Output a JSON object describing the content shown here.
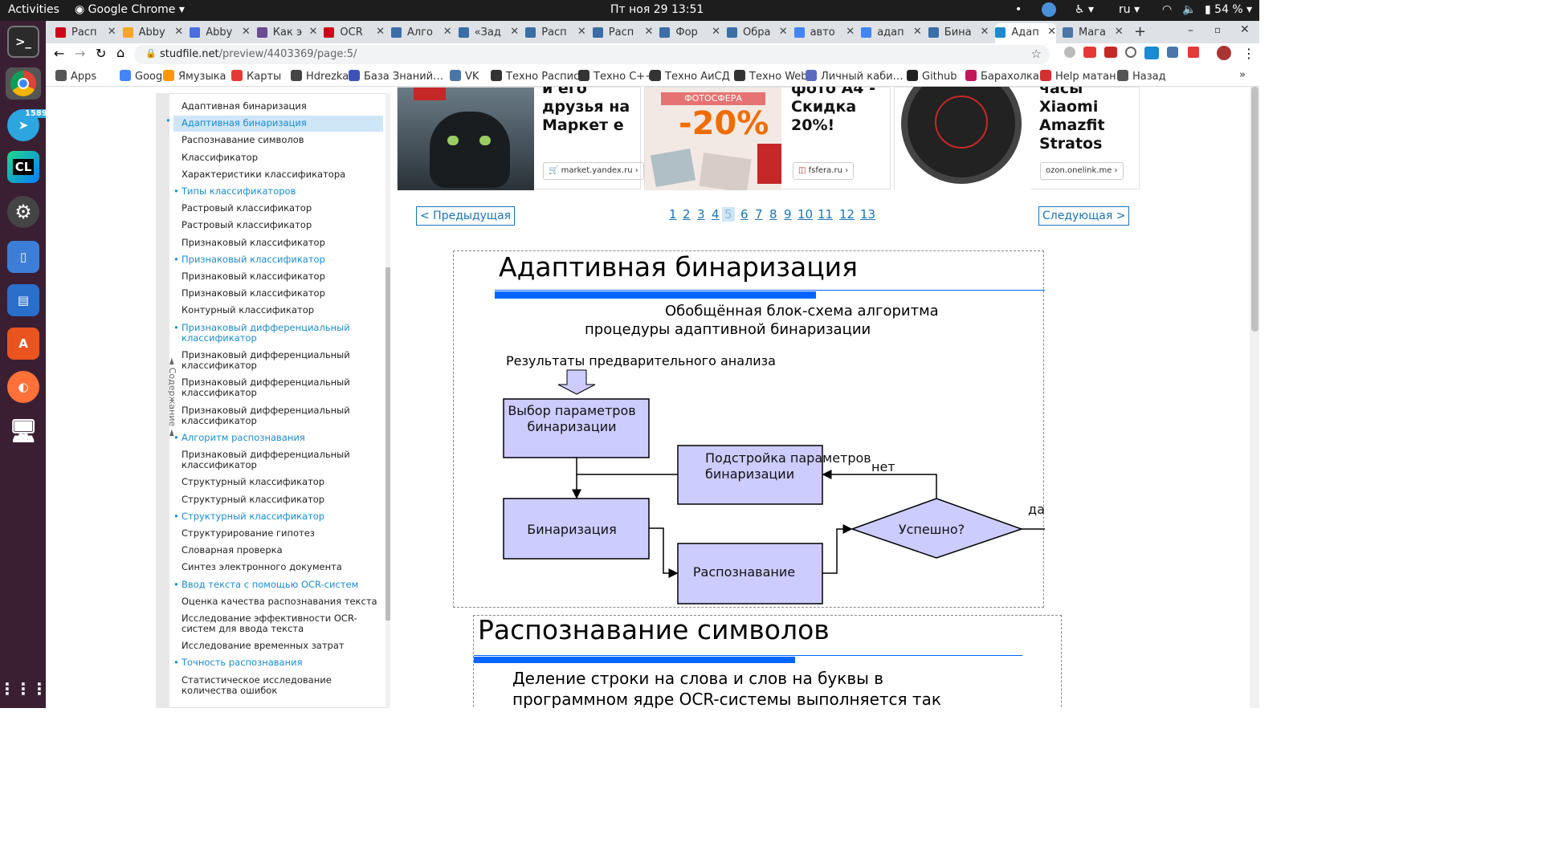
{
  "topbar": {
    "activities": "Activities",
    "app": "Google Chrome",
    "clock": "Пт ноя 29  13:51",
    "lang": "ru",
    "battery": "54 %"
  },
  "dock": {
    "telegram_badge": "1589",
    "clion": "CL"
  },
  "tabs": [
    {
      "label": "Расп",
      "fav": "#d0021b",
      "icon": "yandex-icon"
    },
    {
      "label": "Abby",
      "fav": "#f5a623",
      "icon": "slides-icon"
    },
    {
      "label": "Abby",
      "fav": "#4a6ee0",
      "icon": "docs-icon"
    },
    {
      "label": "Как э",
      "fav": "#6a4c93",
      "icon": "site-icon"
    },
    {
      "label": "OCR",
      "fav": "#d0021b",
      "icon": "yandex-icon"
    },
    {
      "label": "Алго",
      "fav": "#3b6ea5",
      "icon": "habr-icon"
    },
    {
      "label": "«Зад",
      "fav": "#3b6ea5",
      "icon": "habr-icon"
    },
    {
      "label": "Расп",
      "fav": "#3b6ea5",
      "icon": "habr-icon"
    },
    {
      "label": "Расп",
      "fav": "#3b6ea5",
      "icon": "habr-icon"
    },
    {
      "label": "Фор",
      "fav": "#3b6ea5",
      "icon": "habr-icon"
    },
    {
      "label": "Обра",
      "fav": "#3b6ea5",
      "icon": "habr-icon"
    },
    {
      "label": "авто",
      "fav": "#4285f4",
      "icon": "google-icon"
    },
    {
      "label": "адап",
      "fav": "#4285f4",
      "icon": "google-icon"
    },
    {
      "label": "Бина",
      "fav": "#3b6ea5",
      "icon": "habr-icon"
    },
    {
      "label": "Адап",
      "fav": "#1a8bd0",
      "icon": "studfile-icon"
    },
    {
      "label": "Мага",
      "fav": "#4a76a8",
      "icon": "vk-icon"
    }
  ],
  "toolbar": {
    "url_host": "studfile.net",
    "url_path": "/preview/4403369/page:5/"
  },
  "bookmarks": [
    {
      "label": "Apps",
      "color": "#555"
    },
    {
      "label": "Google",
      "color": "#4285f4"
    },
    {
      "label": "Ямузыка",
      "color": "#ff9800"
    },
    {
      "label": "Карты",
      "color": "#e53935"
    },
    {
      "label": "Hdrezka",
      "color": "#444"
    },
    {
      "label": "База Знаний…",
      "color": "#3f51b5"
    },
    {
      "label": "VK",
      "color": "#4a76a8"
    },
    {
      "label": "Техно Распис",
      "color": "#333"
    },
    {
      "label": "Техно С++",
      "color": "#333"
    },
    {
      "label": "Техно АиСД",
      "color": "#333"
    },
    {
      "label": "Техно Web",
      "color": "#333"
    },
    {
      "label": "Личный каби…",
      "color": "#5c6bc0"
    },
    {
      "label": "Github",
      "color": "#222"
    },
    {
      "label": "Барахолка",
      "color": "#c2185b"
    },
    {
      "label": "Help матан",
      "color": "#d32f2f"
    },
    {
      "label": "Назад",
      "color": "#555"
    }
  ],
  "sidebar": {
    "tab_label": "◄ Содержание ◄",
    "items": [
      {
        "label": "Адаптивная бинаризация",
        "style": "plain"
      },
      {
        "label": "Адаптивная бинаризация",
        "style": "selected"
      },
      {
        "label": "Распознавание символов",
        "style": "plain"
      },
      {
        "label": "Классификатор",
        "style": "plain"
      },
      {
        "label": "Характеристики классификатора",
        "style": "plain"
      },
      {
        "label": "Типы классификаторов",
        "style": "blue"
      },
      {
        "label": "Растровый классификатор",
        "style": "plain"
      },
      {
        "label": "Растровый классификатор",
        "style": "plain"
      },
      {
        "label": "Признаковый классификатор",
        "style": "plain"
      },
      {
        "label": "Признаковый классификатор",
        "style": "blue"
      },
      {
        "label": "Признаковый классификатор",
        "style": "plain"
      },
      {
        "label": "Признаковый классификатор",
        "style": "plain"
      },
      {
        "label": "Контурный классификатор",
        "style": "plain"
      },
      {
        "label": "Признаковый дифференциальный классификатор",
        "style": "blue"
      },
      {
        "label": "Признаковый дифференциальный классификатор",
        "style": "plain"
      },
      {
        "label": "Признаковый дифференциальный классификатор",
        "style": "plain"
      },
      {
        "label": "Признаковый дифференциальный классификатор",
        "style": "plain"
      },
      {
        "label": "Алгоритм распознавания",
        "style": "blue"
      },
      {
        "label": "Признаковый дифференциальный классификатор",
        "style": "plain"
      },
      {
        "label": "Структурный классификатор",
        "style": "plain"
      },
      {
        "label": "Структурный классификатор",
        "style": "plain"
      },
      {
        "label": "Структурный классификатор",
        "style": "blue"
      },
      {
        "label": "Структурирование гипотез",
        "style": "plain"
      },
      {
        "label": "Словарная проверка",
        "style": "plain"
      },
      {
        "label": "Синтез электронного документа",
        "style": "plain"
      },
      {
        "label": "Ввод текста с помощью OCR-систем",
        "style": "blue"
      },
      {
        "label": "Оценка качества распознавания текста",
        "style": "plain"
      },
      {
        "label": "Исследование эффективности OCR-систем для ввода текста",
        "style": "plain"
      },
      {
        "label": "Исследование временных затрат",
        "style": "plain"
      },
      {
        "label": "Точность распознавания",
        "style": "blue"
      },
      {
        "label": "Статистическое исследование количества ошибок",
        "style": "plain"
      }
    ]
  },
  "ads": [
    {
      "text": "и его друзья на Маркет е",
      "domain": "market.yandex.ru"
    },
    {
      "text": "фото А4 - Скидка 20%!",
      "domain": "fsfera.ru",
      "banner": "ФОТОСФЕРА",
      "discount": "-20%"
    },
    {
      "text": "часы Xiaomi Amazfit Stratos",
      "domain": "ozon.onelink.me"
    }
  ],
  "pager": {
    "prev": "< Предыдущая",
    "next": "Следующая >",
    "pages": [
      "1",
      "2",
      "3",
      "4",
      "5",
      "6",
      "7",
      "8",
      "9",
      "10",
      "11",
      "12",
      "13"
    ],
    "current": "5"
  },
  "slide1": {
    "title": "Адаптивная бинаризация",
    "subtitle_line1": "Обобщённая блок-схема алгоритма",
    "subtitle_line2": "процедуры адаптивной бинаризации",
    "input_label": "Результаты предварительного анализа",
    "box_select": "Выбор параметров бинаризации",
    "box_tune": "Подстройка параметров бинаризации",
    "box_binarize": "Бинаризация",
    "box_recognize": "Распознавание",
    "decision": "Успешно?",
    "no": "нет",
    "yes": "да",
    "box_fill": "#ccccff",
    "accent": "#0066ff"
  },
  "slide2": {
    "title": "Распознавание символов",
    "line1": "Деление строки на слова и слов на буквы в",
    "line2": "программном ядре OCR-системы выполняется так"
  }
}
